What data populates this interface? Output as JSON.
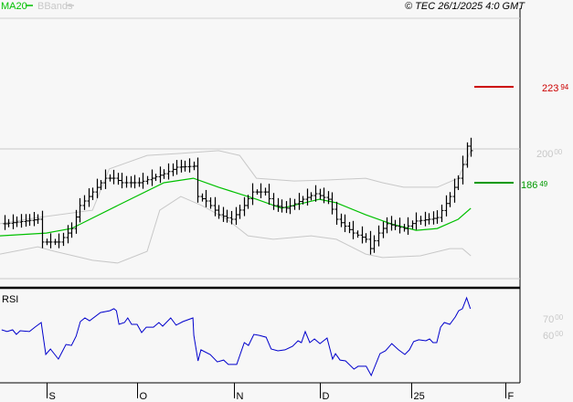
{
  "header": {
    "ma_label": "MA20",
    "bb_label": "BBands",
    "copyright": "© TEC 26/1/2025 4:0 GMT"
  },
  "colors": {
    "ma": "#00c000",
    "bbands": "#c8c8c8",
    "price": "#000000",
    "rsi": "#0000cc",
    "resistance": "#cc0000",
    "support": "#009900",
    "axis_label": "#c8c8c8"
  },
  "levels": {
    "resistance": {
      "int": "223",
      "dec": "94",
      "value": 223.94
    },
    "support": {
      "int": "186",
      "dec": "49",
      "value": 186.49
    },
    "grid": {
      "int": "200",
      "dec": "00",
      "value": 200
    }
  },
  "rsi_panel": {
    "label": "RSI",
    "ticks": [
      {
        "int": "70",
        "dec": "00",
        "value": 70
      },
      {
        "int": "60",
        "dec": "00",
        "value": 60
      }
    ]
  },
  "xaxis": {
    "ticks": [
      {
        "label": "S",
        "day": 11
      },
      {
        "label": "O",
        "day": 32.6
      },
      {
        "label": "N",
        "day": 55.7
      },
      {
        "label": "D",
        "day": 76.1
      },
      {
        "label": "25",
        "day": 97.8
      },
      {
        "label": "F",
        "day": 120.2
      }
    ]
  },
  "chart_data": [
    {
      "type": "line",
      "title": "Price (OHLC bars) with MA20 and Bollinger Bands",
      "x_unit": "trading day index",
      "xlim": [
        0,
        123.7
      ],
      "ylim": [
        147.6,
        250
      ],
      "close": [
        [
          1,
          170.1
        ],
        [
          9,
          171.9
        ],
        [
          10,
          162.8
        ],
        [
          14,
          162.8
        ],
        [
          17,
          168.2
        ],
        [
          19,
          177.4
        ],
        [
          22,
          182.8
        ],
        [
          25,
          188.3
        ],
        [
          27,
          188.3
        ],
        [
          29,
          186.5
        ],
        [
          33,
          186.5
        ],
        [
          36,
          188.3
        ],
        [
          39,
          190.1
        ],
        [
          42,
          192.7
        ],
        [
          46,
          193.1
        ],
        [
          47,
          181.0
        ],
        [
          49,
          179.2
        ],
        [
          52,
          173.7
        ],
        [
          55,
          171.9
        ],
        [
          58,
          177.4
        ],
        [
          60,
          182.8
        ],
        [
          63,
          182.8
        ],
        [
          65,
          177.4
        ],
        [
          68,
          176.3
        ],
        [
          72,
          179.9
        ],
        [
          75,
          182.1
        ],
        [
          78,
          179.9
        ],
        [
          80,
          171.9
        ],
        [
          84,
          166.4
        ],
        [
          87,
          163.9
        ],
        [
          88,
          160.2
        ],
        [
          90,
          166.4
        ],
        [
          92,
          170.1
        ],
        [
          96,
          168.2
        ],
        [
          99,
          171.2
        ],
        [
          102,
          171.9
        ],
        [
          104,
          172.6
        ],
        [
          107,
          181.0
        ],
        [
          109,
          188.3
        ],
        [
          110,
          193.8
        ],
        [
          111,
          201.1
        ],
        [
          112,
          199.3
        ]
      ],
      "ma20": [
        [
          0,
          165.3
        ],
        [
          11,
          166.4
        ],
        [
          17,
          168.2
        ],
        [
          28,
          177.4
        ],
        [
          39,
          186.5
        ],
        [
          46,
          188.3
        ],
        [
          52,
          184.7
        ],
        [
          61,
          179.9
        ],
        [
          67,
          176.3
        ],
        [
          76,
          179.9
        ],
        [
          80,
          178.5
        ],
        [
          87,
          173.7
        ],
        [
          93,
          170.1
        ],
        [
          99,
          167.5
        ],
        [
          104,
          168.2
        ],
        [
          109,
          171.9
        ],
        [
          112,
          176.3
        ]
      ],
      "bb_upper": [
        [
          0,
          170.1
        ],
        [
          9,
          172.6
        ],
        [
          22,
          175.5
        ],
        [
          26,
          192.0
        ],
        [
          35,
          197.4
        ],
        [
          43,
          198.2
        ],
        [
          52,
          199.3
        ],
        [
          57,
          197.4
        ],
        [
          61,
          188.3
        ],
        [
          70,
          187.2
        ],
        [
          78,
          187.6
        ],
        [
          87,
          188.3
        ],
        [
          91,
          186.5
        ],
        [
          96,
          184.7
        ],
        [
          104,
          184.7
        ],
        [
          109,
          188.3
        ],
        [
          112,
          199.3
        ]
      ],
      "bb_lower": [
        [
          0,
          158.0
        ],
        [
          9,
          160.9
        ],
        [
          13,
          159.1
        ],
        [
          22,
          155.5
        ],
        [
          28,
          154.4
        ],
        [
          35,
          159.1
        ],
        [
          38,
          175.5
        ],
        [
          43,
          181.0
        ],
        [
          48,
          177.4
        ],
        [
          54,
          171.9
        ],
        [
          59,
          165.3
        ],
        [
          65,
          163.9
        ],
        [
          74,
          165.3
        ],
        [
          80,
          163.9
        ],
        [
          87,
          158.0
        ],
        [
          91,
          156.6
        ],
        [
          100,
          157.3
        ],
        [
          107,
          160.2
        ],
        [
          110,
          160.2
        ],
        [
          112,
          157.3
        ]
      ]
    },
    {
      "type": "line",
      "title": "RSI",
      "x_unit": "trading day index",
      "xlim": [
        0,
        123.7
      ],
      "series": [
        {
          "name": "RSI",
          "points": [
            [
              0.4,
              62.8
            ],
            [
              1.7,
              61.7
            ],
            [
              3.0,
              62.8
            ],
            [
              3.9,
              60.0
            ],
            [
              4.8,
              62.2
            ],
            [
              7.0,
              61.7
            ],
            [
              8.3,
              64.4
            ],
            [
              9.8,
              67.2
            ],
            [
              10.9,
              47.8
            ],
            [
              12.0,
              51.1
            ],
            [
              13.9,
              45.0
            ],
            [
              15.7,
              53.9
            ],
            [
              17.0,
              53.3
            ],
            [
              18.1,
              58.9
            ],
            [
              19.1,
              67.8
            ],
            [
              20.2,
              70.0
            ],
            [
              21.3,
              68.3
            ],
            [
              23.9,
              73.3
            ],
            [
              26.1,
              74.4
            ],
            [
              27.1,
              75.6
            ],
            [
              27.7,
              74.4
            ],
            [
              28.3,
              66.1
            ],
            [
              29.6,
              67.2
            ],
            [
              30.4,
              70.0
            ],
            [
              31.3,
              66.1
            ],
            [
              32.6,
              66.1
            ],
            [
              33.7,
              61.1
            ],
            [
              34.8,
              64.4
            ],
            [
              36.5,
              64.4
            ],
            [
              37.8,
              67.2
            ],
            [
              38.7,
              65.0
            ],
            [
              40.6,
              70.0
            ],
            [
              41.9,
              65.6
            ],
            [
              43.5,
              67.8
            ],
            [
              45.9,
              70.0
            ],
            [
              46.1,
              59.4
            ],
            [
              47.1,
              43.9
            ],
            [
              47.8,
              50.6
            ],
            [
              50.0,
              47.8
            ],
            [
              51.7,
              43.3
            ],
            [
              53.2,
              44.4
            ],
            [
              54.3,
              41.7
            ],
            [
              56.3,
              41.7
            ],
            [
              58.1,
              55.0
            ],
            [
              59.1,
              53.3
            ],
            [
              60.4,
              60.0
            ],
            [
              61.7,
              59.4
            ],
            [
              63.3,
              58.3
            ],
            [
              64.5,
              51.1
            ],
            [
              66.1,
              50.0
            ],
            [
              67.8,
              50.6
            ],
            [
              69.6,
              52.8
            ],
            [
              70.9,
              56.1
            ],
            [
              71.7,
              55.0
            ],
            [
              72.6,
              61.7
            ],
            [
              73.7,
              55.0
            ],
            [
              74.8,
              57.2
            ],
            [
              76.1,
              54.4
            ],
            [
              77.8,
              57.8
            ],
            [
              79.1,
              45.0
            ],
            [
              79.8,
              48.3
            ],
            [
              80.9,
              44.4
            ],
            [
              82.2,
              43.9
            ],
            [
              84.2,
              38.9
            ],
            [
              85.2,
              40.6
            ],
            [
              87.1,
              40.6
            ],
            [
              88.3,
              35.0
            ],
            [
              90.4,
              48.3
            ],
            [
              91.7,
              50.0
            ],
            [
              93.2,
              54.4
            ],
            [
              94.8,
              50.6
            ],
            [
              96.3,
              47.8
            ],
            [
              97.4,
              50.6
            ],
            [
              98.4,
              55.6
            ],
            [
              99.6,
              56.7
            ],
            [
              101.3,
              56.1
            ],
            [
              102.2,
              57.2
            ],
            [
              103.0,
              55.0
            ],
            [
              103.9,
              55.0
            ],
            [
              104.8,
              64.4
            ],
            [
              105.7,
              67.2
            ],
            [
              107.0,
              66.1
            ],
            [
              108.3,
              70.6
            ],
            [
              109.1,
              74.4
            ],
            [
              110.0,
              75.6
            ],
            [
              111.0,
              82.2
            ],
            [
              111.9,
              75.6
            ]
          ]
        }
      ]
    }
  ]
}
